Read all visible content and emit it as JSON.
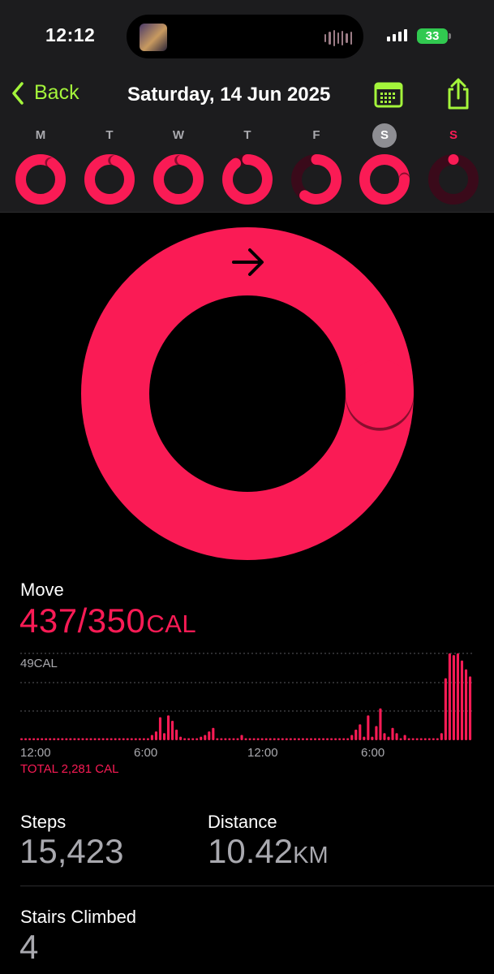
{
  "status_bar": {
    "time": "12:12",
    "battery": "33",
    "island_art_icon": "album-art-icon",
    "island_wave_icon": "audio-waveform-icon"
  },
  "header": {
    "back_label": "Back",
    "date_title": "Saturday, 14 Jun 2025",
    "accent_color": "#a4f53b"
  },
  "week": [
    {
      "letter": "M",
      "progress": 1.1
    },
    {
      "letter": "T",
      "progress": 1.05
    },
    {
      "letter": "W",
      "progress": 1.03
    },
    {
      "letter": "T",
      "progress": 0.9
    },
    {
      "letter": "F",
      "progress": 0.6
    },
    {
      "letter": "S",
      "progress": 1.25,
      "selected": true
    },
    {
      "letter": "S",
      "progress": 0.03
    }
  ],
  "move": {
    "label": "Move",
    "value": "437/350",
    "unit": "CAL",
    "progress": 1.25,
    "color": "#fa1b55"
  },
  "chart_data": {
    "type": "bar",
    "ymax_label": "49CAL",
    "ymax": 49,
    "x_ticks": [
      "12:00",
      "6:00",
      "12:00",
      "6:00"
    ],
    "total_label": "TOTAL 2,281 CAL",
    "values": [
      1,
      1,
      1,
      1,
      1,
      1,
      1,
      1,
      1,
      1,
      1,
      1,
      1,
      1,
      1,
      1,
      1,
      1,
      1,
      1,
      1,
      1,
      1,
      1,
      1,
      1,
      1,
      1,
      1,
      1,
      1,
      1,
      3,
      5,
      13,
      4,
      14,
      11,
      6,
      2,
      1,
      1,
      1,
      1,
      2,
      3,
      5,
      7,
      1,
      1,
      1,
      1,
      1,
      1,
      3,
      1,
      1,
      1,
      1,
      1,
      1,
      1,
      1,
      1,
      1,
      1,
      1,
      1,
      1,
      1,
      1,
      1,
      1,
      1,
      1,
      1,
      1,
      1,
      1,
      1,
      1,
      3,
      6,
      9,
      2,
      14,
      2,
      8,
      18,
      4,
      2,
      7,
      4,
      1,
      3,
      1,
      1,
      1,
      1,
      1,
      1,
      1,
      1,
      4,
      35,
      49,
      48,
      49,
      45,
      40,
      36
    ]
  },
  "stats": {
    "steps_label": "Steps",
    "steps_value": "15,423",
    "distance_label": "Distance",
    "distance_value": "10.42",
    "distance_unit": "KM",
    "stairs_label": "Stairs Climbed",
    "stairs_value": "4"
  }
}
